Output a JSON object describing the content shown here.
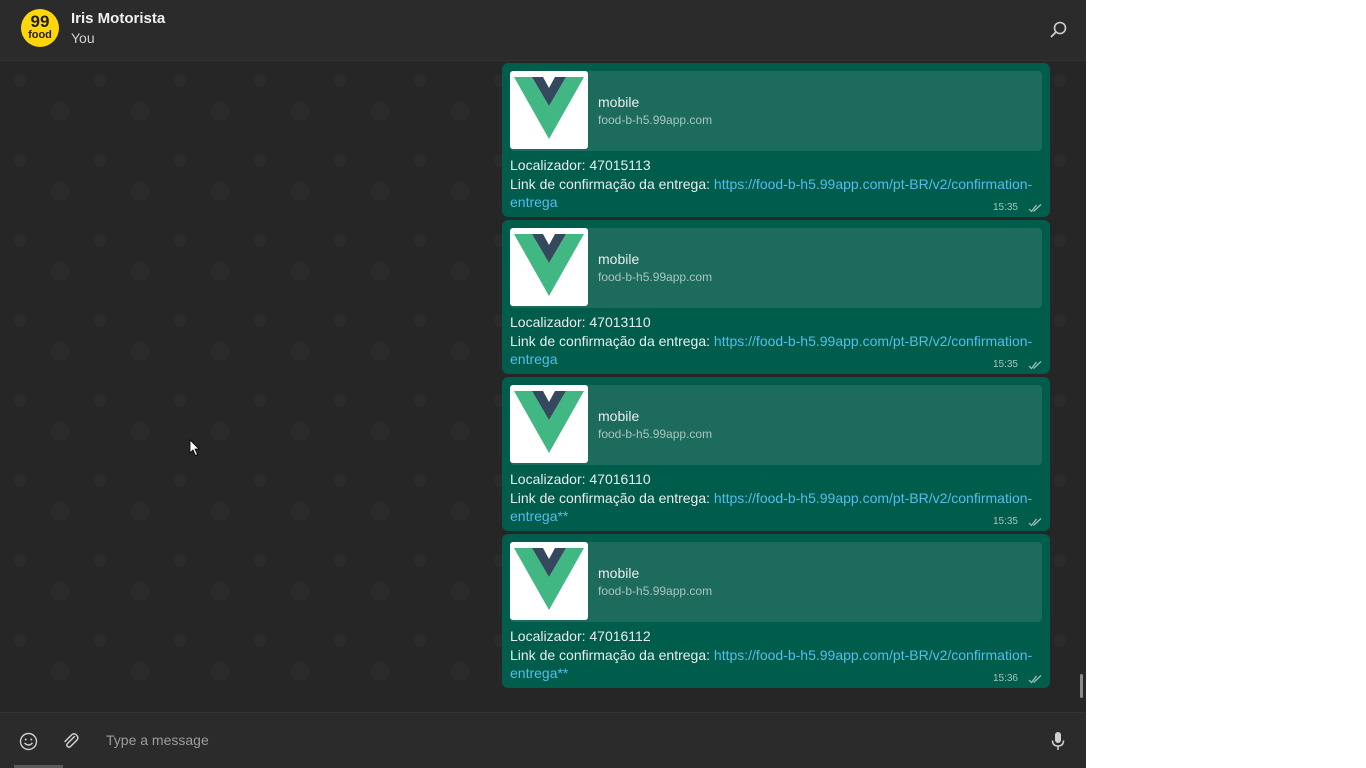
{
  "contact": {
    "avatar_top": "99",
    "avatar_bottom": "food",
    "name": "Iris Motorista",
    "subtitle": "You"
  },
  "composer": {
    "placeholder": "Type a message"
  },
  "messages": [
    {
      "preview_title": "mobile",
      "preview_host": "food-b-h5.99app.com",
      "line1": "Localizador: 47015113",
      "line2_prefix": "Link de confirmação da entrega: ",
      "link": "https://food-b-h5.99app.com/pt-BR/v2/confirmation-entrega",
      "time": "15:35"
    },
    {
      "preview_title": "mobile",
      "preview_host": "food-b-h5.99app.com",
      "line1": "Localizador: 47013110",
      "line2_prefix": "Link de confirmação da entrega: ",
      "link": "https://food-b-h5.99app.com/pt-BR/v2/confirmation-entrega",
      "time": "15:35"
    },
    {
      "preview_title": "mobile",
      "preview_host": "food-b-h5.99app.com",
      "line1": "Localizador: 47016110",
      "line2_prefix": "Link de confirmação da entrega: ",
      "link": "https://food-b-h5.99app.com/pt-BR/v2/confirmation-entrega**",
      "time": "15:35"
    },
    {
      "preview_title": "mobile",
      "preview_host": "food-b-h5.99app.com",
      "line1": "Localizador: 47016112",
      "line2_prefix": "Link de confirmação da entrega: ",
      "link": "https://food-b-h5.99app.com/pt-BR/v2/confirmation-entrega**",
      "time": "15:36"
    }
  ],
  "icons": {
    "search": "search-icon",
    "emoji": "emoji-icon",
    "attach": "paperclip-icon",
    "mic": "microphone-icon",
    "read_receipt": "double-check-icon",
    "preview_logo": "vue-logo-icon"
  },
  "colors": {
    "header_bg": "#2b2b2b",
    "chat_bg": "#262626",
    "bubble_out": "#005c4b",
    "preview_bg": "#1d6b5c",
    "link": "#53bdeb",
    "avatar": "#ffd60a",
    "vue_green": "#41b883",
    "vue_dark": "#34495e"
  }
}
